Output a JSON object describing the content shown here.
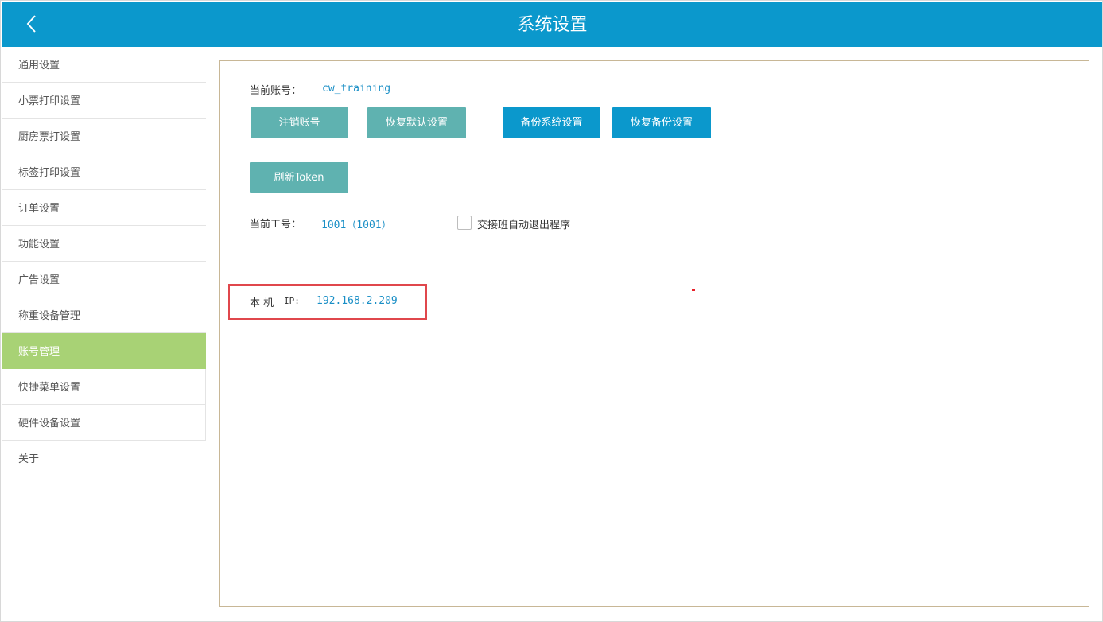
{
  "header": {
    "title": "系统设置",
    "back_icon": "chevron-left-icon"
  },
  "sidebar": {
    "items": [
      {
        "label": "通用设置"
      },
      {
        "label": "小票打印设置"
      },
      {
        "label": "厨房票打设置"
      },
      {
        "label": "标签打印设置"
      },
      {
        "label": "订单设置"
      },
      {
        "label": "功能设置"
      },
      {
        "label": "广告设置"
      },
      {
        "label": "称重设备管理"
      },
      {
        "label": "账号管理",
        "active": true
      },
      {
        "label": "快捷菜单设置"
      },
      {
        "label": "硬件设备设置"
      },
      {
        "label": "关于"
      }
    ]
  },
  "account": {
    "current_account_label": "当前账号：",
    "current_account_value": "cw_training",
    "buttons": {
      "logout": "注销账号",
      "restore_default": "恢复默认设置",
      "backup": "备份系统设置",
      "restore_backup": "恢复备份设置",
      "refresh_token": "刷新Token"
    },
    "employee_label": "当前工号：",
    "employee_value": "1001（1001）",
    "auto_exit_label": "交接班自动退出程序",
    "auto_exit_checked": false,
    "ip_label": "本 机",
    "ip_key": "IP:",
    "ip_value": "192.168.2.209"
  },
  "colors": {
    "header": "#0b98cc",
    "active_item": "#a8d275",
    "teal_button": "#5fb2b0",
    "blue_button": "#0b98cc",
    "highlight_box": "#e0474c"
  }
}
